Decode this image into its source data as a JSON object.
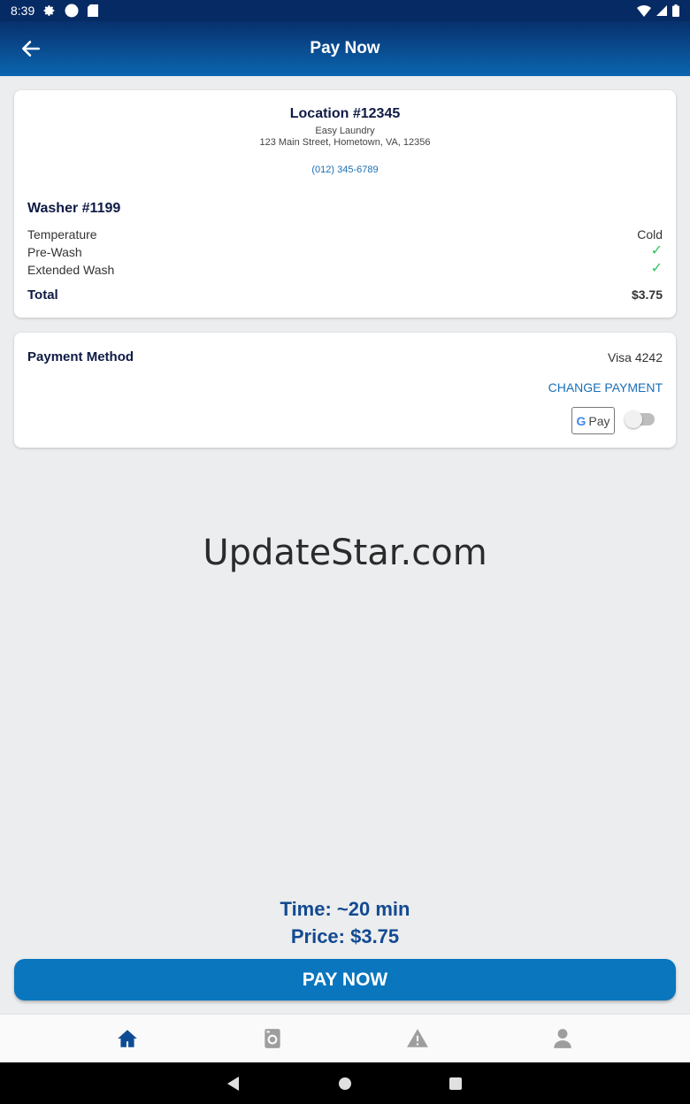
{
  "status_bar": {
    "time": "8:39"
  },
  "app_bar": {
    "title": "Pay Now"
  },
  "location": {
    "title": "Location #12345",
    "name": "Easy Laundry",
    "address": "123 Main Street, Hometown, VA, 12356",
    "phone": "(012) 345-6789"
  },
  "washer": {
    "title": "Washer #1199",
    "options": [
      {
        "label": "Temperature",
        "value": "Cold"
      },
      {
        "label": "Pre-Wash",
        "value": "✓"
      },
      {
        "label": "Extended Wash",
        "value": "✓"
      }
    ],
    "total_label": "Total",
    "total_value": "$3.75"
  },
  "payment": {
    "label": "Payment Method",
    "card": "Visa 4242",
    "change_label": "CHANGE PAYMENT",
    "gpay_text": "Pay",
    "gpay_enabled": false
  },
  "watermark": "UpdateStar.com",
  "summary": {
    "time": "Time: ~20 min",
    "price": "Price: $3.75"
  },
  "pay_button": "PAY NOW",
  "bottom_nav": {
    "icons": [
      "home-icon",
      "washer-icon",
      "alert-icon",
      "profile-icon"
    ],
    "active_color": "#0d4c95",
    "inactive_color": "#9e9e9e"
  },
  "colors": {
    "primary": "#0a76be",
    "navy": "#0f1a45",
    "link": "#1a6fb5",
    "check": "#31c35a"
  }
}
